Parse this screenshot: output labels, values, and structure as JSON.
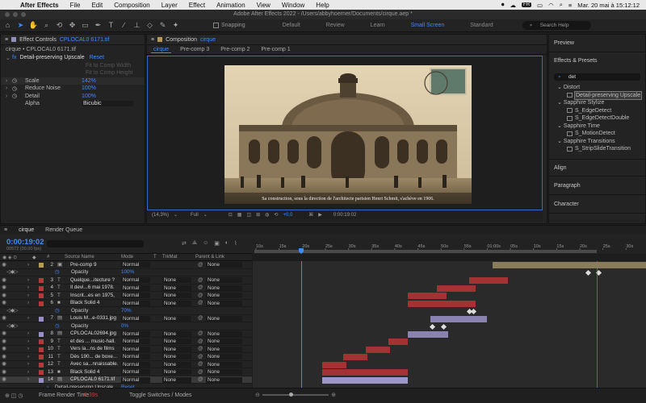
{
  "menubar": {
    "app": "After Effects",
    "items": [
      "File",
      "Edit",
      "Composition",
      "Layer",
      "Effect",
      "Animation",
      "View",
      "Window",
      "Help"
    ],
    "badge": "FR",
    "clock": "Mar. 20 mai à 15:12:12"
  },
  "window": {
    "title": "Adobe After Effects 2022 - /Users/abbyhoerner/Documents/cirque.aep *"
  },
  "toolbar": {
    "snapping": "Snapping",
    "workspaces": [
      "Default",
      "Review",
      "Learn",
      "Small Screen",
      "Standard"
    ],
    "active_workspace": "Small Screen",
    "search_placeholder": "Search Help"
  },
  "effect_controls": {
    "tab_label": "Effect Controls",
    "tab_file": "CPLOCAL0 6171.tif",
    "path": "cirque • CPLOCAL0 6171.tif",
    "effect_name": "Detail-preserving Upscale",
    "reset": "Reset",
    "btn_fit_width": "Fit to Comp Width",
    "btn_fit_height": "Fit to Comp Height",
    "props": [
      {
        "label": "Scale",
        "value": "142%"
      },
      {
        "label": "Reduce Noise",
        "value": "100%"
      },
      {
        "label": "Detail",
        "value": "100%"
      },
      {
        "label": "Alpha",
        "value": "Bicubic"
      }
    ]
  },
  "composition": {
    "tab_label": "Composition",
    "tab_name": "cirque",
    "subtabs": [
      "cirque",
      "Pre-comp 3",
      "Pre-comp 2",
      "Pre-comp 1"
    ],
    "subtitle": "Sa construction, sous la direction de l'architecte parisien Henri Schmit, s'achève en 1906.",
    "zoom": "(14,3%)",
    "quality": "Full",
    "exposure": "+0,0",
    "time": "0:00:19:02"
  },
  "right": {
    "preview": "Preview",
    "effects_presets": "Effects & Presets",
    "search_value": "det",
    "tree": [
      {
        "type": "cat",
        "label": "Distort"
      },
      {
        "type": "item",
        "label": "Detail-preserving Upscale",
        "highlight": true
      },
      {
        "type": "cat",
        "label": "Sapphire Stylize"
      },
      {
        "type": "item",
        "label": "S_EdgeDetect"
      },
      {
        "type": "item",
        "label": "S_EdgeDetectDouble"
      },
      {
        "type": "cat",
        "label": "Sapphire Time"
      },
      {
        "type": "item",
        "label": "S_MotionDetect"
      },
      {
        "type": "cat",
        "label": "Sapphire Transitions"
      },
      {
        "type": "item",
        "label": "S_StripSlideTransition"
      }
    ],
    "align": "Align",
    "paragraph": "Paragraph",
    "character": "Character"
  },
  "timeline": {
    "tabs": [
      "cirque",
      "Render Queue"
    ],
    "timecode": "0:00:19:02",
    "timecode_sub": "00572 (30.00 fps)",
    "col_headers": {
      "source": "Source Name",
      "mode": "Mode",
      "t": "T",
      "trkmat": "TrkMat",
      "parent": "Parent & Link"
    },
    "ruler_labels": [
      "10s",
      "15s",
      "20s",
      "25s",
      "30s",
      "35s",
      "40s",
      "45s",
      "50s",
      "55s",
      "01:00s",
      "05s",
      "10s",
      "15s",
      "20s",
      "25s",
      "30s"
    ],
    "rows": [
      {
        "kind": "layer",
        "num": "2",
        "label_color": "#b89a55",
        "type": "▣",
        "name": "Pre-comp 9",
        "mode": "Normal",
        "trkmat": "",
        "parent": "None"
      },
      {
        "kind": "prop",
        "name": "Opacity",
        "value": "100%"
      },
      {
        "kind": "layer",
        "num": "3",
        "label_color": "#b33a3a",
        "type": "T",
        "name": "Quelque...itecture ?",
        "mode": "Normal",
        "trkmat": "None",
        "parent": "None"
      },
      {
        "kind": "layer",
        "num": "4",
        "label_color": "#b33a3a",
        "type": "T",
        "name": "Il devi...6 mai 1978.",
        "mode": "Normal",
        "trkmat": "None",
        "parent": "None"
      },
      {
        "kind": "layer",
        "num": "5",
        "label_color": "#b33a3a",
        "type": "T",
        "name": "Inscrit...es en 1975,",
        "mode": "Normal",
        "trkmat": "None",
        "parent": "None"
      },
      {
        "kind": "layer",
        "num": "6",
        "label_color": "#b33a3a",
        "type": "■",
        "name": "Black Solid 4",
        "mode": "Normal",
        "trkmat": "None",
        "parent": "None"
      },
      {
        "kind": "prop",
        "name": "Opacity",
        "value": "70%"
      },
      {
        "kind": "layer",
        "num": "7",
        "label_color": "#9b8fc7",
        "type": "▤",
        "name": "Louis M...e-0331.jpg",
        "mode": "Normal",
        "trkmat": "None",
        "parent": "None"
      },
      {
        "kind": "prop",
        "name": "Opacity",
        "value": "0%"
      },
      {
        "kind": "layer",
        "num": "8",
        "label_color": "#9b8fc7",
        "type": "▤",
        "name": "CPLOCAL02694.jpg",
        "mode": "Normal",
        "trkmat": "None",
        "parent": "None"
      },
      {
        "kind": "layer",
        "num": "9",
        "label_color": "#b33a3a",
        "type": "T",
        "name": "et des ... music-hall.",
        "mode": "Normal",
        "trkmat": "None",
        "parent": "None"
      },
      {
        "kind": "layer",
        "num": "10",
        "label_color": "#b33a3a",
        "type": "T",
        "name": "Vers la...ns de films",
        "mode": "Normal",
        "trkmat": "None",
        "parent": "None"
      },
      {
        "kind": "layer",
        "num": "11",
        "label_color": "#b33a3a",
        "type": "T",
        "name": "Dès 190... de boxe...",
        "mode": "Normal",
        "trkmat": "None",
        "parent": "None"
      },
      {
        "kind": "layer",
        "num": "12",
        "label_color": "#b33a3a",
        "type": "T",
        "name": "Avec sa...nnaissable.",
        "mode": "Normal",
        "trkmat": "None",
        "parent": "None"
      },
      {
        "kind": "layer",
        "num": "13",
        "label_color": "#b33a3a",
        "type": "■",
        "name": "Black Solid 4",
        "mode": "Normal",
        "trkmat": "None",
        "parent": "None"
      },
      {
        "kind": "layer",
        "num": "14",
        "label_color": "#9b8fc7",
        "type": "▤",
        "name": "CPLOCAL0 6171.tif",
        "mode": "Normal",
        "trkmat": "None",
        "parent": "None",
        "selected": true
      },
      {
        "kind": "effect",
        "name": "Detail-preserving Upscale",
        "value": "Reset"
      }
    ],
    "footer": {
      "render_label": "Frame Render Time",
      "render_value": "6,39s",
      "toggle": "Toggle Switches / Modes"
    }
  },
  "colors": {
    "accent": "#3d8bff",
    "red_label": "#b33a3a",
    "lavender_label": "#9b8fc7",
    "tan_label": "#b89a55"
  }
}
